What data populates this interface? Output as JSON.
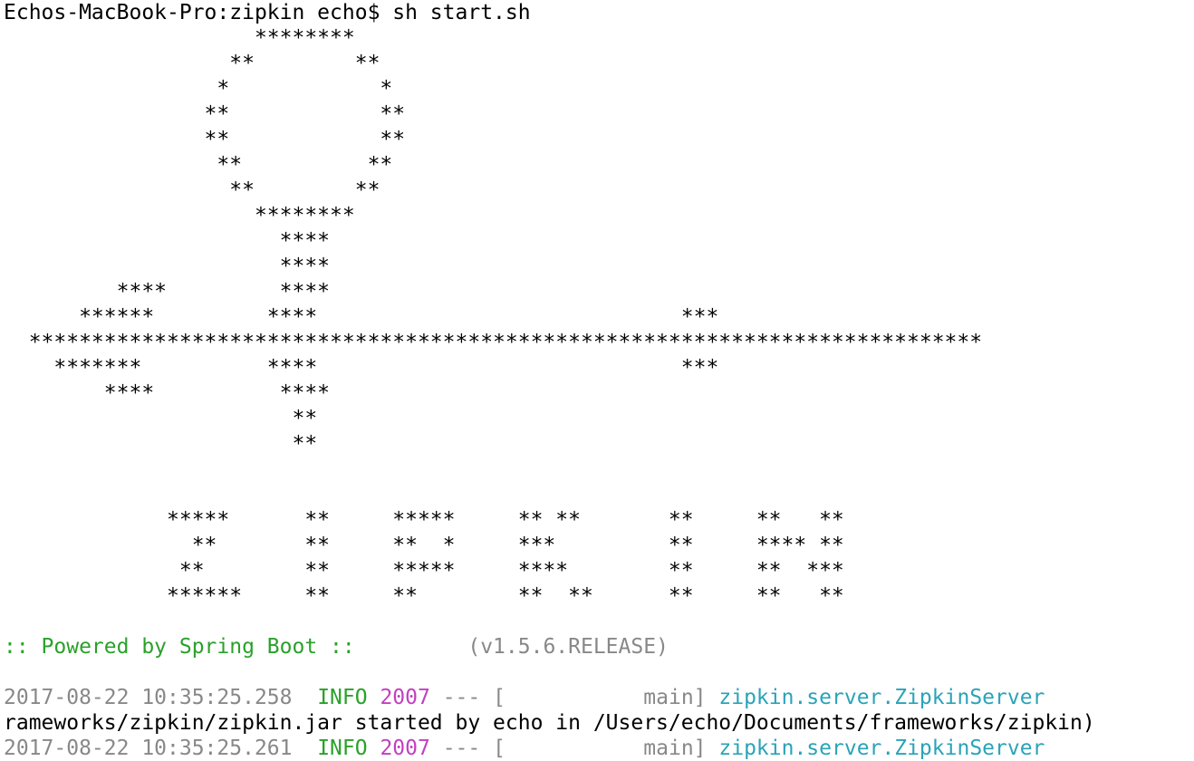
{
  "terminal": {
    "prompt": "Echos-MacBook-Pro:zipkin echo$ sh start.sh",
    "banner_lines": [
      "                    ********",
      "                  **        **",
      "                 *            *",
      "                **            **",
      "                **            **",
      "                 **          **",
      "                  **        **",
      "                    ********",
      "                      ****",
      "                      ****",
      "         ****         ****",
      "      ******         ****                             ***",
      "  ****************************************************************************",
      "    *******          ****                             ***",
      "        ****          ****",
      "                       **",
      "                       **",
      "",
      "",
      "             *****      **     *****     ** **       **     **   **",
      "               **       **     **  *     ***         **     **** **",
      "              **        **     *****     ****        **     **  ***",
      "             ******     **     **        **  **      **     **   **"
    ],
    "spring": {
      "powered_by": ":: Powered by Spring Boot ::",
      "version": "(v1.5.6.RELEASE)"
    },
    "log": [
      {
        "timestamp": "2017-08-22 10:35:25.258",
        "level": "INFO",
        "pid": "2007",
        "sep": "---",
        "thread": "[           main]",
        "logger": "zipkin.server.ZipkinServer"
      },
      {
        "text": "rameworks/zipkin/zipkin.jar started by echo in /Users/echo/Documents/frameworks/zipkin)"
      },
      {
        "timestamp": "2017-08-22 10:35:25.261",
        "level": "INFO",
        "pid": "2007",
        "sep": "---",
        "thread": "[           main]",
        "logger": "zipkin.server.ZipkinServer"
      }
    ]
  },
  "colors": {
    "background": "#ffffff",
    "text": "#000000",
    "green": "#2aa12a",
    "gray": "#888888",
    "magenta": "#c23fc2",
    "cyan": "#2aa3b8"
  }
}
